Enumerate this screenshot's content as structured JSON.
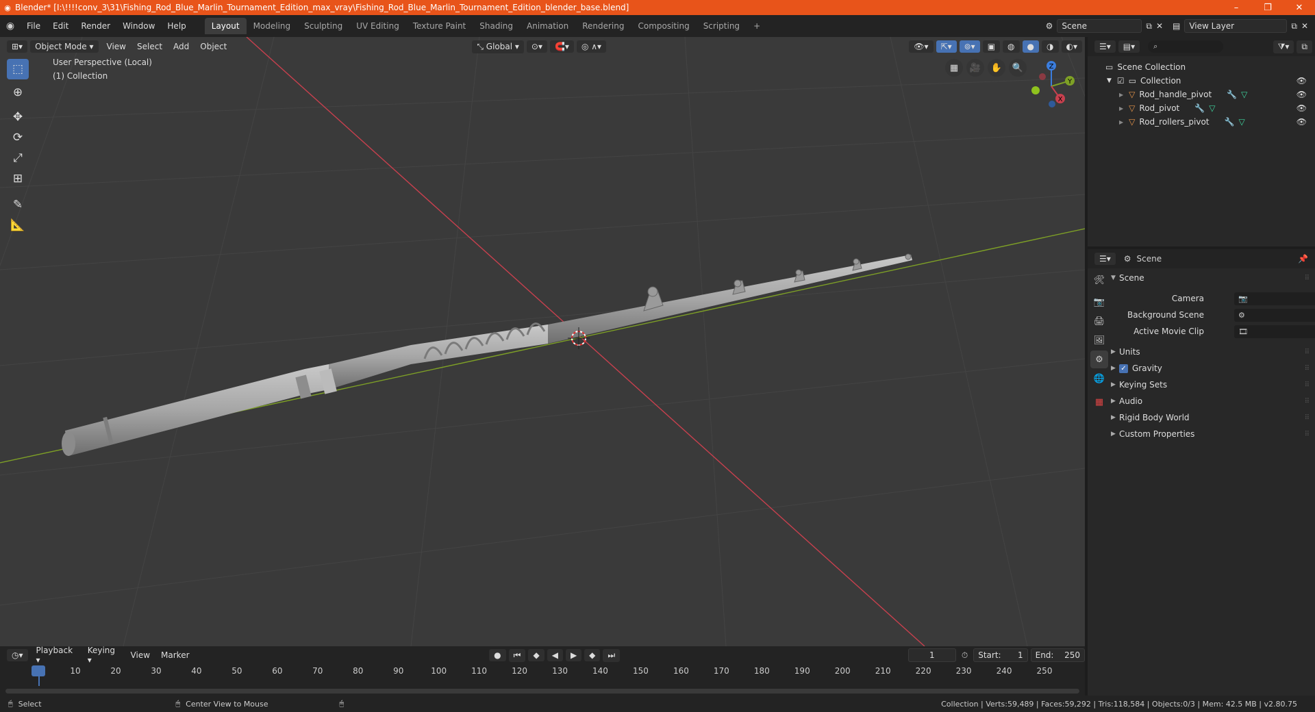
{
  "window": {
    "title": "Blender* [I:\\!!!!conv_3\\31\\Fishing_Rod_Blue_Marlin_Tournament_Edition_max_vray\\Fishing_Rod_Blue_Marlin_Tournament_Edition_blender_base.blend]",
    "minimize": "–",
    "maximize": "❐",
    "close": "✕"
  },
  "menu": [
    "File",
    "Edit",
    "Render",
    "Window",
    "Help"
  ],
  "workspaces": [
    "Layout",
    "Modeling",
    "Sculpting",
    "UV Editing",
    "Texture Paint",
    "Shading",
    "Animation",
    "Rendering",
    "Compositing",
    "Scripting"
  ],
  "workspace_add": "+",
  "scene_field": "Scene",
  "view_layer_field": "View Layer",
  "viewport": {
    "mode": "Object Mode",
    "menus": [
      "View",
      "Select",
      "Add",
      "Object"
    ],
    "transform_orientation": "Global",
    "perspective_label": "User Perspective (Local)",
    "collection_label": "(1) Collection",
    "gizmo": {
      "z": "Z",
      "y": "Y",
      "x": "X"
    }
  },
  "outliner": {
    "search_placeholder": "",
    "scene_collection": "Scene Collection",
    "collection": "Collection",
    "objects": [
      "Rod_handle_pivot",
      "Rod_pivot",
      "Rod_rollers_pivot"
    ]
  },
  "properties": {
    "header": "Scene",
    "section": "Scene",
    "fields": [
      {
        "label": "Camera"
      },
      {
        "label": "Background Scene"
      },
      {
        "label": "Active Movie Clip"
      }
    ],
    "subsections": [
      "Units",
      "Gravity",
      "Keying Sets",
      "Audio",
      "Rigid Body World",
      "Custom Properties"
    ]
  },
  "timeline": {
    "menus": [
      "Playback",
      "Keying",
      "View",
      "Marker"
    ],
    "current_frame": "1",
    "start_label": "Start:",
    "start_value": "1",
    "end_label": "End:",
    "end_value": "250",
    "ticks": [
      "1",
      "10",
      "20",
      "30",
      "40",
      "50",
      "60",
      "70",
      "80",
      "90",
      "100",
      "110",
      "120",
      "130",
      "140",
      "150",
      "160",
      "170",
      "180",
      "190",
      "200",
      "210",
      "220",
      "230",
      "240",
      "250"
    ]
  },
  "status": {
    "left_action": "Select",
    "middle_action": "Center View to Mouse",
    "stats": "Collection | Verts:59,489 | Faces:59,292 | Tris:118,584 | Objects:0/3 | Mem: 42.5 MB | v2.80.75"
  },
  "colors": {
    "titlebar": "#e8541a",
    "accent": "#4772b3",
    "x_axis": "#c8404e",
    "y_axis": "#7ea026",
    "z_axis": "#3b7ddd"
  }
}
